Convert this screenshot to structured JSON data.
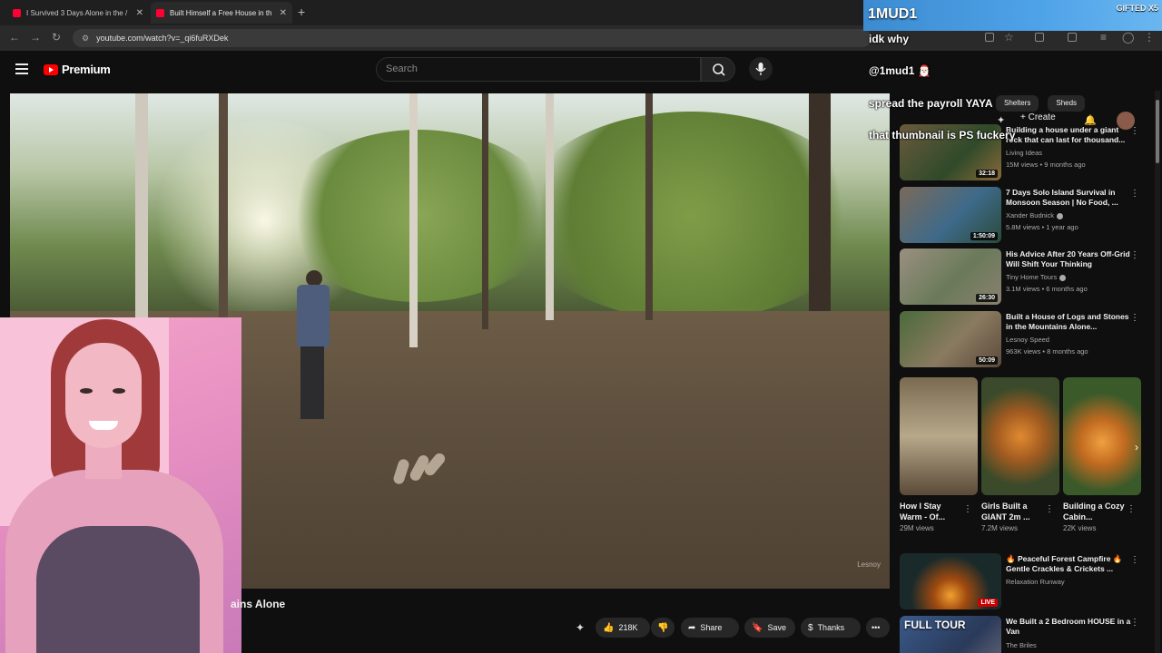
{
  "browser": {
    "tabs": [
      {
        "title": "I Survived 3 Days Alone in the /",
        "close": "✕"
      },
      {
        "title": "Built Himself a Free House in th",
        "close": "✕"
      }
    ],
    "new_tab": "+",
    "url": "youtube.com/watch?v=_qi6fuRXDek"
  },
  "youtube": {
    "logo_text": "Premium",
    "search_placeholder": "Search",
    "create_label": "Create"
  },
  "video": {
    "title_partial": "ains Alone",
    "watermark": "Lesnoy"
  },
  "actions": {
    "likes": "218K",
    "share": "Share",
    "save": "Save",
    "thanks": "Thanks",
    "more": "•••"
  },
  "chips": [
    "Shelters",
    "Sheds"
  ],
  "recommendations": [
    {
      "title": "Building a house under a giant rock that can last for thousand...",
      "channel": "Living Ideas",
      "verified": false,
      "meta": "15M views • 9 months ago",
      "duration": "32:18"
    },
    {
      "title": "7 Days Solo Island Survival in Monsoon Season | No Food, ...",
      "channel": "Xander Budnick",
      "verified": true,
      "meta": "5.8M views • 1 year ago",
      "duration": "1:50:09"
    },
    {
      "title": "His Advice After 20 Years Off-Grid Will Shift Your Thinking",
      "channel": "Tiny Home Tours",
      "verified": true,
      "meta": "3.1M views • 6 months ago",
      "duration": "26:30"
    },
    {
      "title": "Built a House of Logs and Stones in the Mountains Alone...",
      "channel": "Lesnoy Speed",
      "verified": false,
      "meta": "963K views • 8 months ago",
      "duration": "50:09"
    }
  ],
  "shorts": [
    {
      "title": "How I Stay Warm - Of...",
      "views": "29M views"
    },
    {
      "title": "Girls Built a GIANT 2m ...",
      "views": "7.2M views"
    },
    {
      "title": "Building a Cozy Cabin...",
      "views": "22K views"
    }
  ],
  "recommendations_lower": [
    {
      "title": "🔥 Peaceful Forest Campfire 🔥 Gentle Crackles & Crickets ...",
      "channel": "Relaxation Runway",
      "live": "LIVE"
    },
    {
      "title": "We Built a 2 Bedroom HOUSE in a Van",
      "channel": "The Briles",
      "thumb_text": "FULL TOUR"
    }
  ],
  "chat": {
    "header_name": "1MUD1",
    "header_badge": "GIFTED X5",
    "messages": [
      {
        "text": "idk why"
      },
      {
        "text": "@1mud1 🎅🏻"
      },
      {
        "text": "spread the payroll YAYA"
      },
      {
        "text": "that thumbnail is PS fuckery"
      }
    ]
  },
  "colors": {
    "yt_red": "#ff0000",
    "bg": "#0f0f0f",
    "chat_header": "#4fa3e8"
  }
}
